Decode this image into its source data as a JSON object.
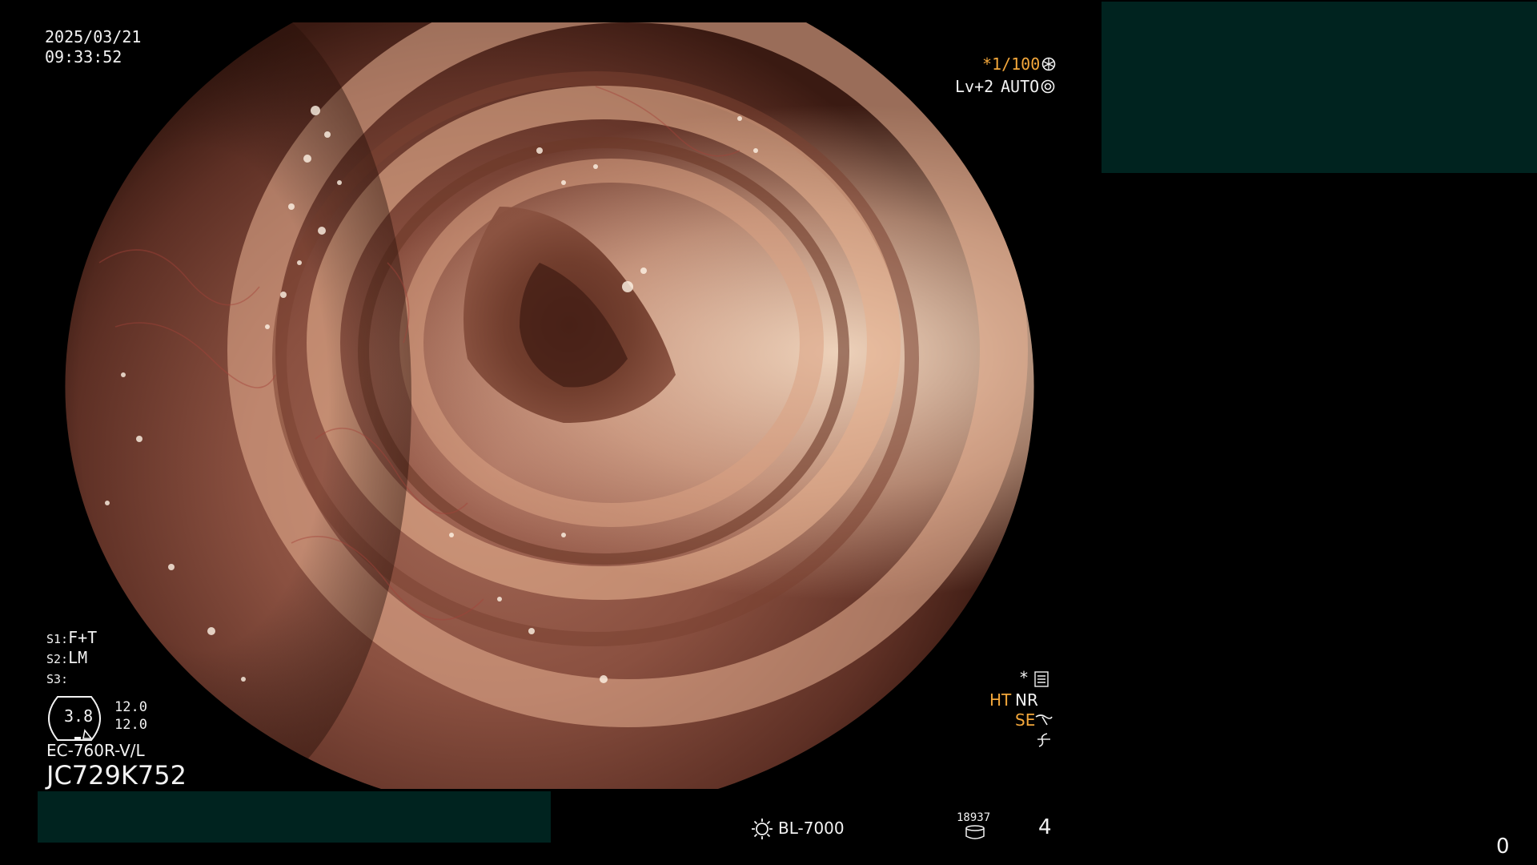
{
  "osd": {
    "date": "2025/03/21",
    "time": "09:33:52",
    "shutter": "*1/100",
    "level": "Lv+2",
    "iris_mode": "AUTO",
    "s1": "S1:",
    "s1_value": "F+T",
    "s2": "S2:",
    "s2_value": "LM",
    "s3": "S3:",
    "zoom_value": "3.8",
    "range_top": "12.0",
    "range_bottom": "12.0",
    "scope_model": "EC-760R-V/L",
    "scope_serial": "JC729K752",
    "star": "*",
    "ht": "HT",
    "nr": "NR",
    "se": "SE",
    "light_source": "BL-7000",
    "counter": "18937",
    "channel": "4",
    "corner_number": "0"
  },
  "colors": {
    "panel": "#00231f",
    "accent_orange": "#f3a73b",
    "osd_text": "#f2f2f2"
  },
  "icons": [
    "ring-icon",
    "iris-icon",
    "settings-icon",
    "structure-enhance-icon",
    "color-enhance-icon",
    "light-source-icon",
    "storage-icon"
  ]
}
